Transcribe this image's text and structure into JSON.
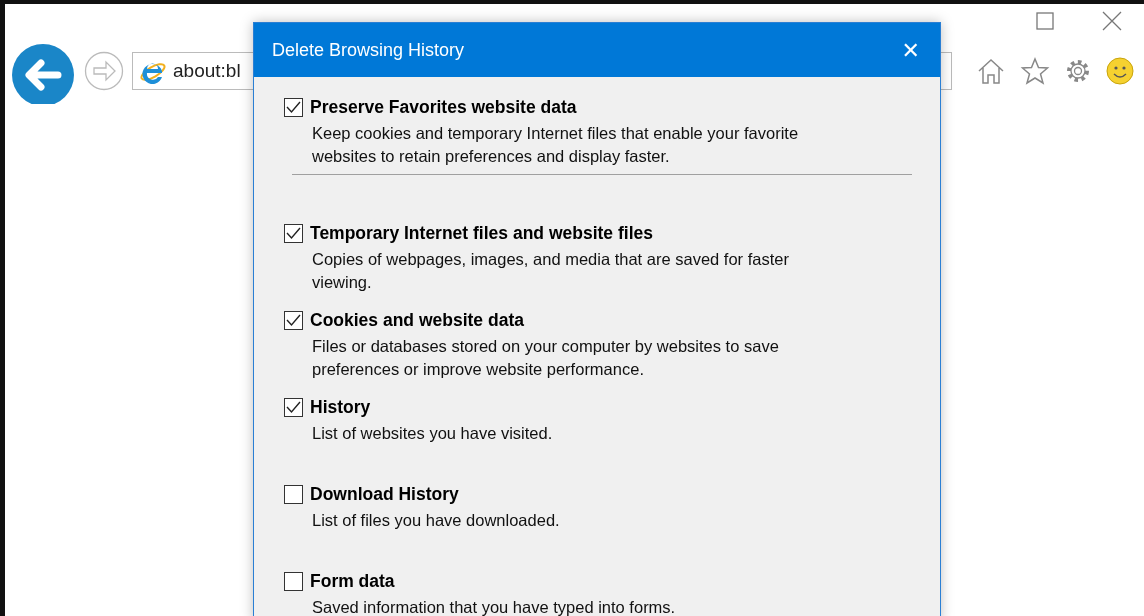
{
  "browser": {
    "address": "about:bl"
  },
  "dialog": {
    "title": "Delete Browsing History",
    "close": "✕",
    "items": [
      {
        "label": "Preserve Favorites website data",
        "checked": true,
        "lines": [
          "Keep cookies and temporary Internet files that enable your favorite",
          "websites to retain preferences and display faster."
        ],
        "separator_after": true
      },
      {
        "label": "Temporary Internet files and website files",
        "checked": true,
        "lines": [
          "Copies of webpages, images, and media that are saved for faster",
          "viewing."
        ],
        "separator_after": false
      },
      {
        "label": "Cookies and website data",
        "checked": true,
        "lines": [
          "Files or databases stored on your computer by websites to save",
          "preferences or improve website performance."
        ],
        "separator_after": false
      },
      {
        "label": "History",
        "checked": true,
        "lines": [
          "List of websites you have visited."
        ],
        "separator_after": false
      },
      {
        "label": "Download History",
        "checked": false,
        "lines": [
          "List of files you have downloaded."
        ],
        "separator_after": false
      },
      {
        "label": "Form data",
        "checked": false,
        "lines": [
          "Saved information that you have typed into forms."
        ],
        "separator_after": false
      }
    ]
  }
}
